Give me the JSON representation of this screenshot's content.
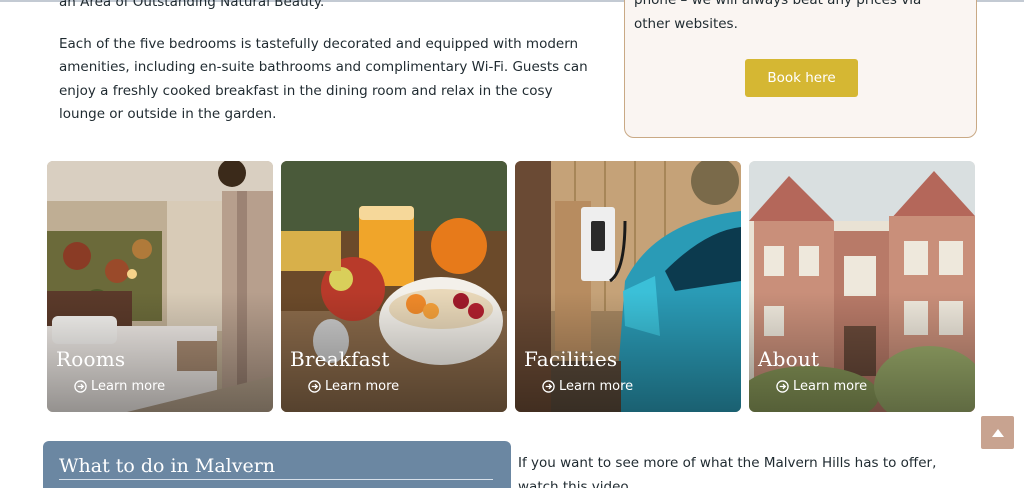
{
  "intro": {
    "line_top": "an Area of Outstanding Natural Beauty.",
    "paragraph": "Each of the five bedrooms is tastefully decorated and equipped with modern amenities, including en-suite bathrooms and complimentary Wi-Fi. Guests can enjoy a freshly cooked breakfast in the dining room and relax in the cosy lounge or outside in the garden."
  },
  "booking": {
    "text": "phone – we will always beat any prices via other websites.",
    "button_label": "Book here"
  },
  "cards": [
    {
      "title": "Rooms",
      "link": "Learn more"
    },
    {
      "title": "Breakfast",
      "link": "Learn more"
    },
    {
      "title": "Facilities",
      "link": "Learn more"
    },
    {
      "title": "About",
      "link": "Learn more"
    }
  ],
  "section": {
    "heading": "What to do in Malvern",
    "video_text": "If you want to see more of what the Malvern Hills has to offer, watch this video"
  },
  "icons": {
    "learn_more": "circle-arrow-right-icon",
    "scroll_top": "chevron-up-icon"
  },
  "colors": {
    "button": "#d5b733",
    "booking_bg": "#faf5f2",
    "booking_border": "#c9a985",
    "section_bg": "#6b87a2",
    "scroll_top_bg": "#c8a390",
    "text": "#1f2a30"
  }
}
